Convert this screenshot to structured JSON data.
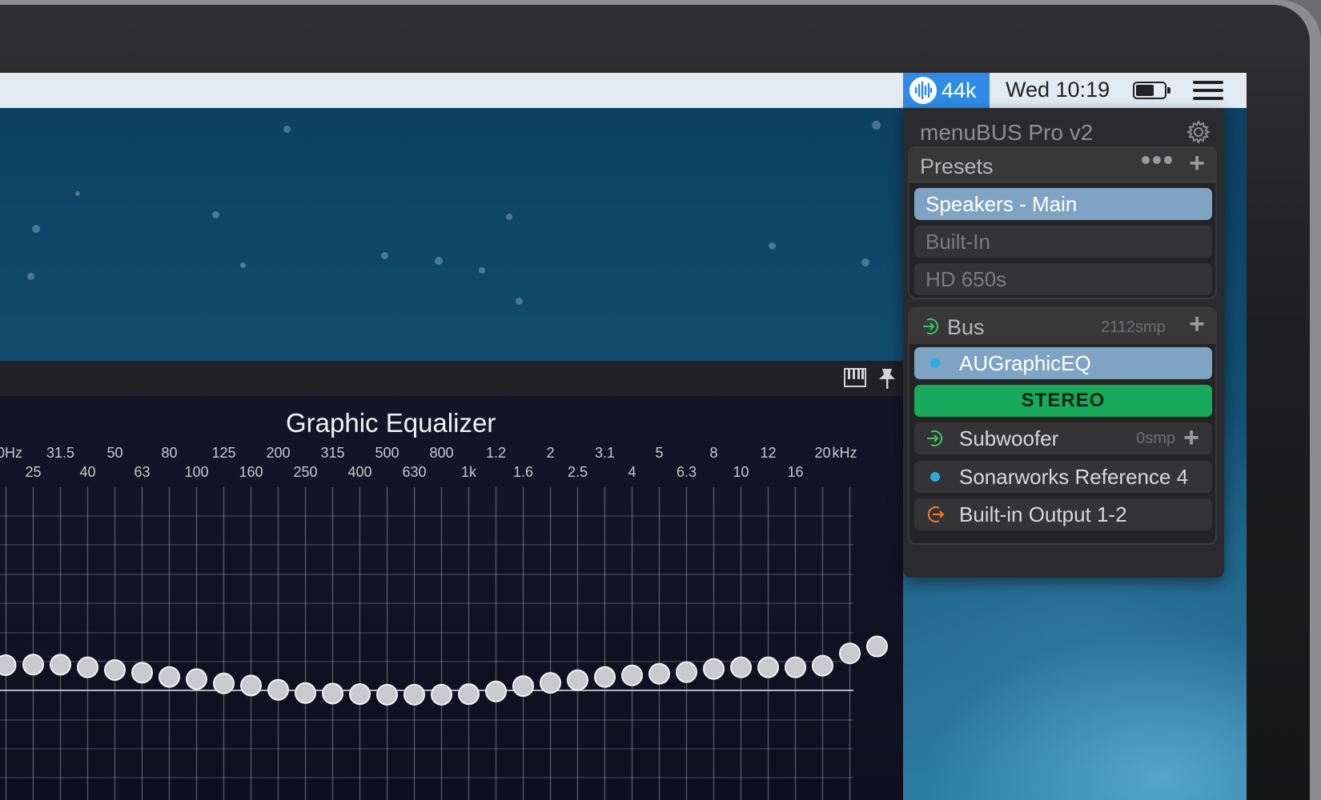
{
  "menubar": {
    "app_label": "44k",
    "clock": "Wed 10:19"
  },
  "eq_window": {
    "title": "Graphic Equalizer",
    "hz_unit_clipped": "0Hz",
    "khz_unit": "kHz",
    "top_labels": [
      "31.5",
      "50",
      "80",
      "125",
      "200",
      "315",
      "500",
      "800",
      "1.2",
      "2",
      "3.1",
      "5",
      "8",
      "12",
      "20"
    ],
    "bottom_labels": [
      "25",
      "40",
      "63",
      "100",
      "160",
      "250",
      "400",
      "630",
      "1k",
      "1.6",
      "2.5",
      "4",
      "6.3",
      "10",
      "16"
    ],
    "band_gains_relative": [
      0.59,
      0.6,
      0.6,
      0.55,
      0.5,
      0.45,
      0.37,
      0.33,
      0.25,
      0.21,
      0.13,
      0.07,
      0.06,
      0.05,
      0.04,
      0.04,
      0.04,
      0.05,
      0.1,
      0.2,
      0.26,
      0.31,
      0.37,
      0.4,
      0.43,
      0.46,
      0.52,
      0.55,
      0.55,
      0.55,
      0.58,
      0.81,
      0.94
    ]
  },
  "panel": {
    "title": "menuBUS Pro v2",
    "presets": {
      "label": "Presets",
      "items": [
        {
          "label": "Speakers - Main",
          "selected": true
        },
        {
          "label": "Built-In",
          "selected": false
        },
        {
          "label": "HD 650s",
          "selected": false
        }
      ]
    },
    "bus": {
      "label": "Bus",
      "latency": "2112smp",
      "plugin": "AUGraphicEQ",
      "mode": "STEREO",
      "subwoofer": {
        "label": "Subwoofer",
        "latency": "0smp"
      },
      "reference": "Sonarworks Reference 4",
      "output": "Built-in Output 1-2"
    }
  },
  "colors": {
    "menubar_app_bg": "#2f8be6",
    "selected_row": "#7fa3c3",
    "stereo_green": "#18a95b",
    "input_icon_green": "#3bc468",
    "output_icon_orange": "#f07a2a",
    "plugin_dot_blue": "#2fa8e0"
  }
}
